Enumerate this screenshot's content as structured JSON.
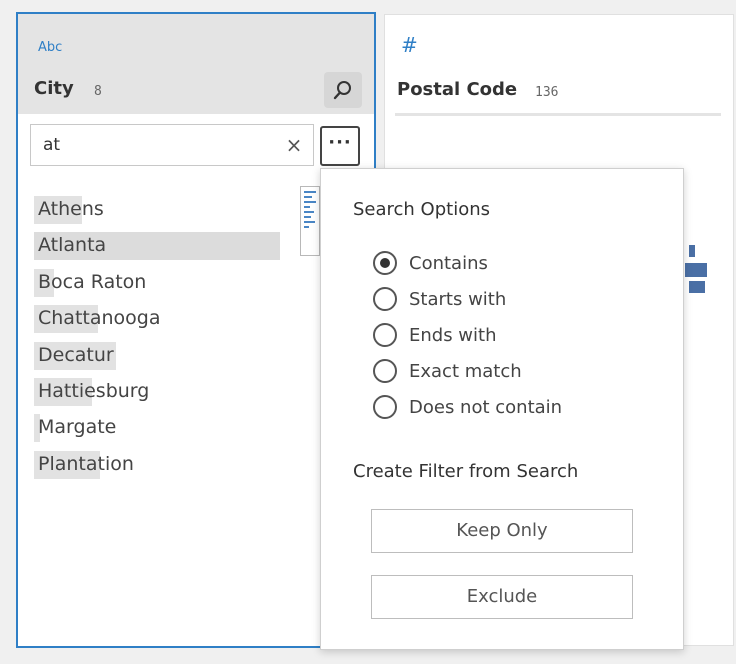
{
  "city": {
    "type_label": "Abc",
    "field_name": "City",
    "count": "8",
    "search_icon": "search-icon",
    "search_value": "at",
    "clear_icon": "×",
    "more_label": "···",
    "values": [
      "Athens",
      "Atlanta",
      "Boca Raton",
      "Chattanooga",
      "Decatur",
      "Hattiesburg",
      "Margate",
      "Plantation"
    ]
  },
  "postal": {
    "type_label": "#",
    "field_name": "Postal Code",
    "count": "136"
  },
  "search_options": {
    "title": "Search Options",
    "options": [
      "Contains",
      "Starts with",
      "Ends with",
      "Exact match",
      "Does not contain"
    ],
    "selected": "Contains",
    "filter_title": "Create Filter from Search",
    "keep_only": "Keep Only",
    "exclude": "Exclude"
  },
  "colors": {
    "accent": "#2f7fc6",
    "bar": "#4a6fa5",
    "highlight": "#e2e2e2"
  }
}
